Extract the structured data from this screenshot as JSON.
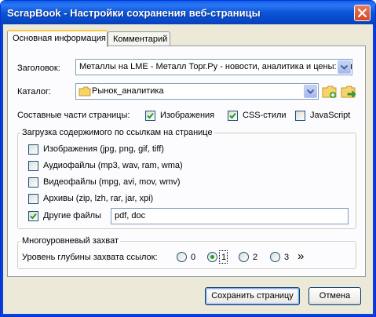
{
  "window": {
    "title": "ScrapBook - Настройки сохранения веб-страницы",
    "close_icon": "close-icon"
  },
  "tabs": [
    {
      "label": "Основная информация",
      "selected": true
    },
    {
      "label": "Комментарий",
      "selected": false
    }
  ],
  "title_field": {
    "label": "Заголовок:",
    "value": "Металлы на LME - Металл Торг.Ру - новости, аналитика и цены: метал"
  },
  "folder_field": {
    "label": "Каталог:",
    "value": "Рынок_аналитика",
    "icon": "folder-icon",
    "new_folder_icon": "new-folder-icon",
    "move_folder_icon": "go-folder-icon"
  },
  "components": {
    "label": "Составные части страницы:",
    "options": [
      {
        "label": "Изображения",
        "checked": true
      },
      {
        "label": "CSS-стили",
        "checked": true
      },
      {
        "label": "JavaScript",
        "checked": false
      }
    ]
  },
  "linked_content": {
    "legend": "Загрузка содержимого по ссылкам на странице",
    "options": [
      {
        "label": "Изображения (jpg, png, gif, tiff)",
        "checked": false
      },
      {
        "label": "Аудиофайлы (mp3, wav, ram, wma)",
        "checked": false
      },
      {
        "label": "Видеофайлы (mpg, avi, mov, wmv)",
        "checked": false
      },
      {
        "label": "Архивы (zip, lzh, rar, jar, xpi)",
        "checked": false
      },
      {
        "label": "Другие файлы",
        "checked": true
      }
    ],
    "other_files_value": "pdf, doc"
  },
  "multilevel": {
    "legend": "Многоуровневый захват",
    "depth_label": "Уровень глубины захвата ссылок:",
    "levels": [
      {
        "label": "0",
        "selected": false
      },
      {
        "label": "1",
        "selected": true
      },
      {
        "label": "2",
        "selected": false
      },
      {
        "label": "3",
        "selected": false
      }
    ],
    "more_label": "»"
  },
  "buttons": {
    "save": "Сохранить страницу",
    "cancel": "Отмена"
  }
}
